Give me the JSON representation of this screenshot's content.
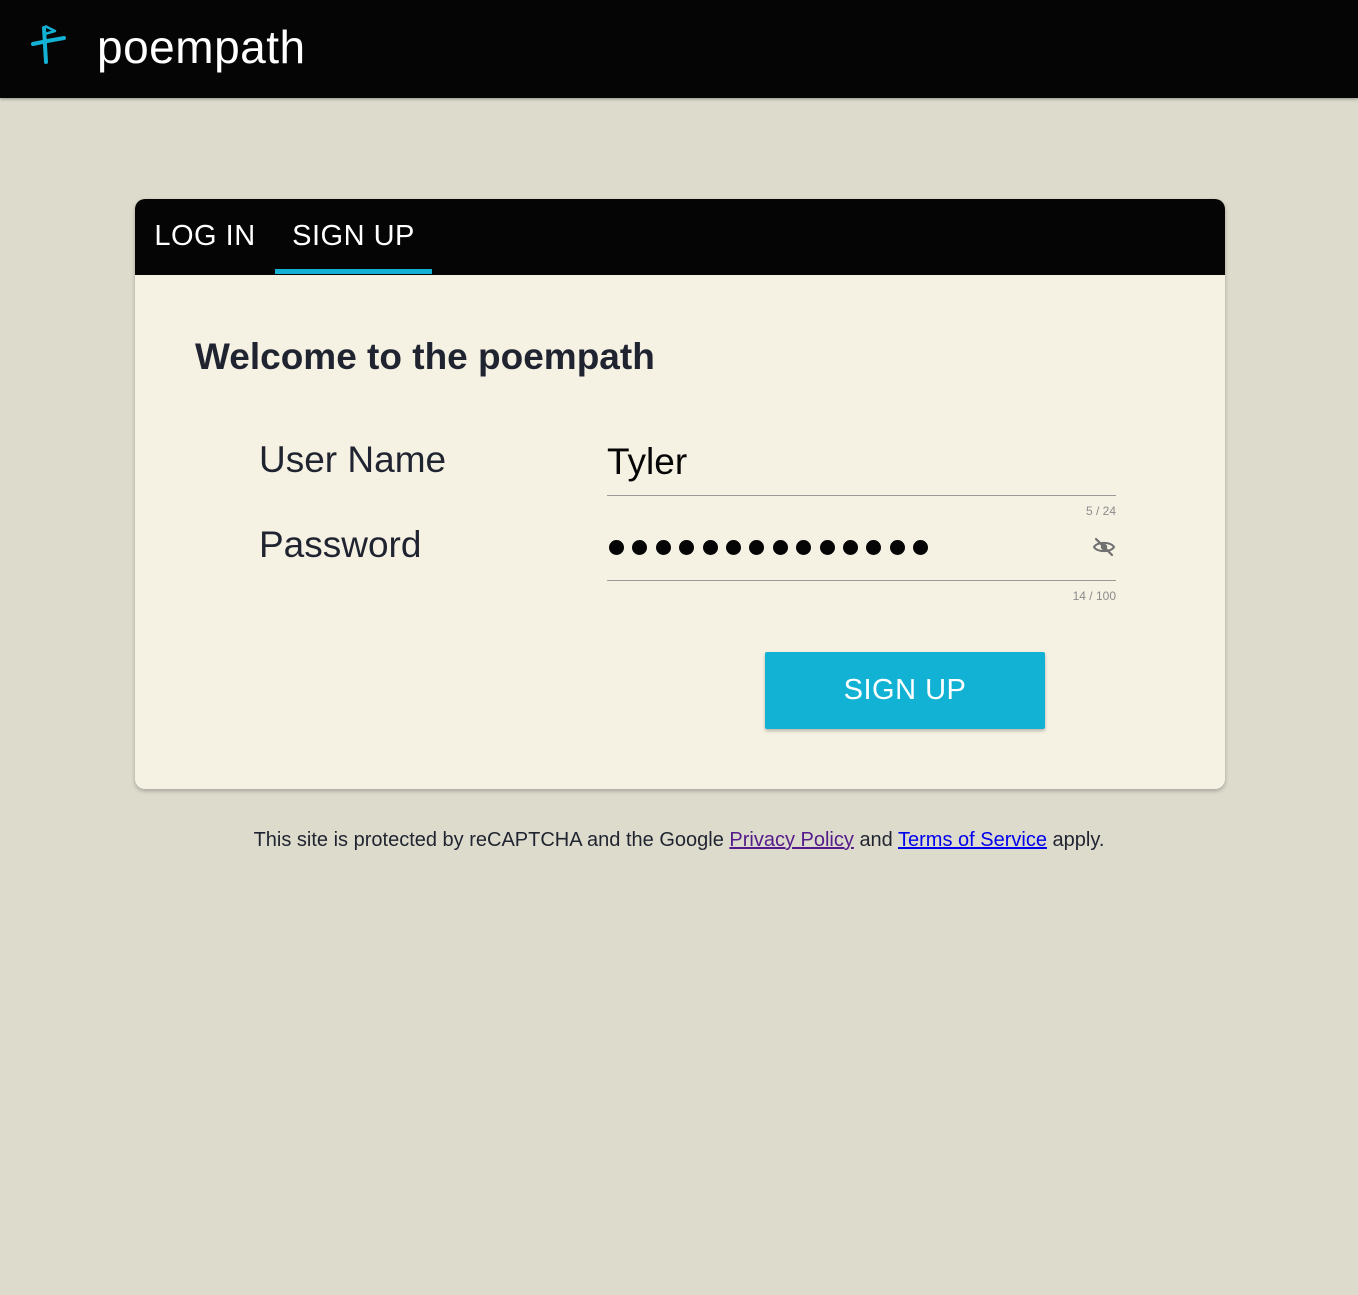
{
  "header": {
    "brand": "poempath",
    "logo_icon": "poempath-logo-icon",
    "accent_color": "#13b1d4"
  },
  "tabs": [
    {
      "label": "LOG IN",
      "active": false
    },
    {
      "label": "SIGN UP",
      "active": true
    }
  ],
  "form": {
    "title": "Welcome to the poempath",
    "username": {
      "label": "User Name",
      "value": "Tyler",
      "counter": "5 / 24"
    },
    "password": {
      "label": "Password",
      "masked_length": 14,
      "counter": "14 / 100",
      "visibility_icon": "eye-off-icon"
    },
    "submit_label": "SIGN UP"
  },
  "footer": {
    "text_before": "This site is protected by reCAPTCHA and the Google",
    "privacy_link": "Privacy Policy",
    "text_middle": "and",
    "terms_link": "Terms of Service",
    "text_after": "apply."
  }
}
